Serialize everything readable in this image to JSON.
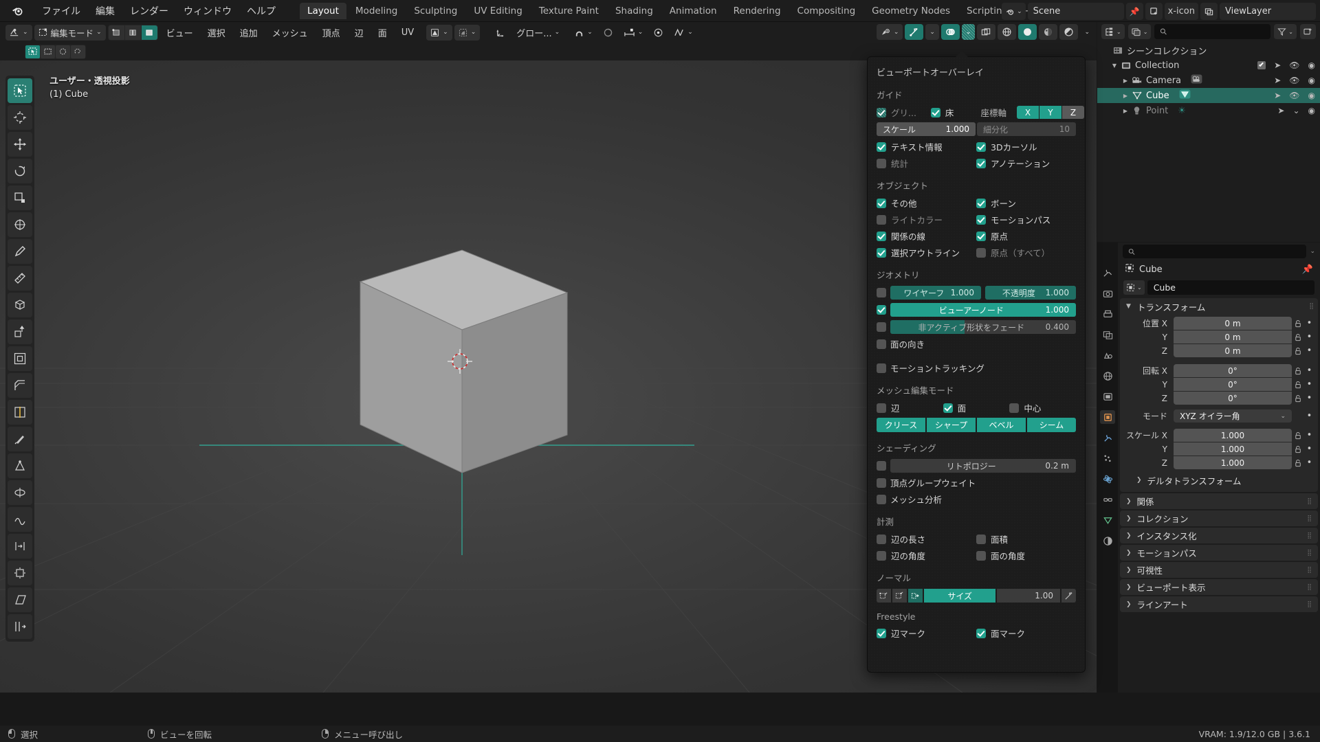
{
  "topbar": {
    "logo_icon": "blender-logo-icon",
    "menus": [
      "ファイル",
      "編集",
      "レンダー",
      "ウィンドウ",
      "ヘルプ"
    ],
    "workspace_tabs": [
      {
        "label": "Layout",
        "active": true
      },
      {
        "label": "Modeling",
        "active": false
      },
      {
        "label": "Sculpting",
        "active": false
      },
      {
        "label": "UV Editing",
        "active": false
      },
      {
        "label": "Texture Paint",
        "active": false
      },
      {
        "label": "Shading",
        "active": false
      },
      {
        "label": "Animation",
        "active": false
      },
      {
        "label": "Rendering",
        "active": false
      },
      {
        "label": "Compositing",
        "active": false
      },
      {
        "label": "Geometry Nodes",
        "active": false
      },
      {
        "label": "Scripting",
        "active": false
      }
    ],
    "add_workspace_label": "+",
    "scene_icon": "scene-icon",
    "scene_name": "Scene",
    "pin_icon": "pin-icon",
    "new_scene_icon": "new-scene-icon",
    "copy_scene_icon": "copy-scene-icon",
    "delete_scene_icon": "x-icon",
    "viewlayer_icon": "view-layer-icon",
    "viewlayer_name": "ViewLayer"
  },
  "viewport_header": {
    "editor_type_icon": "editor-type-icon",
    "mode_icon": "edit-mode-icon",
    "mode_label": "編集モード",
    "select_modes": [
      {
        "name": "vertex-select-mode",
        "on": false
      },
      {
        "name": "edge-select-mode",
        "on": false
      },
      {
        "name": "face-select-mode",
        "on": true
      }
    ],
    "menus": [
      "ビュー",
      "選択",
      "追加",
      "メッシュ",
      "頂点",
      "辺",
      "面",
      "UV"
    ],
    "mesh_option_icons": [
      "mesh-display-icon",
      "uv-option-icon"
    ],
    "transform_orientation_icon": "orientation-icon",
    "transform_orientation_label": "グロー...",
    "snap_icon": "magnet-icon",
    "proportional_icon": "proportional-edit-icon",
    "proportional_falloff_icon": "falloff-icon",
    "mirror_icon": "mirror-x-icon",
    "right_icons": [
      {
        "name": "object-type-visibility-icon",
        "on": false
      },
      {
        "name": "gizmo-icon",
        "on": true
      },
      {
        "name": "overlays-icon",
        "on": true
      },
      {
        "name": "overlays-dropdown-icon",
        "on": true
      },
      {
        "name": "xray-toggle-icon",
        "on": false
      },
      {
        "name": "shading-wireframe-icon",
        "on": false
      },
      {
        "name": "shading-solid-icon",
        "on": true
      },
      {
        "name": "shading-material-icon",
        "on": false
      },
      {
        "name": "shading-rendered-icon",
        "on": false
      }
    ]
  },
  "viewport_subrow": {
    "select_tool_modes": [
      {
        "name": "tweak-select-tool",
        "on": true
      },
      {
        "name": "box-select-tool",
        "on": false
      },
      {
        "name": "circle-select-tool",
        "on": false
      },
      {
        "name": "lasso-select-tool",
        "on": false
      }
    ]
  },
  "viewport": {
    "view_name": "ユーザー・透視投影",
    "object_info": "(1) Cube",
    "tools": [
      {
        "name": "tweak-tool",
        "active": true
      },
      {
        "name": "cursor-tool",
        "active": false
      },
      {
        "name": "move-tool",
        "active": false
      },
      {
        "name": "rotate-tool",
        "active": false
      },
      {
        "name": "scale-tool",
        "active": false
      },
      {
        "name": "transform-tool",
        "active": false
      },
      {
        "name": "annotate-tool",
        "active": false
      },
      {
        "name": "measure-tool",
        "active": false
      },
      {
        "name": "add-cube-tool",
        "active": false
      },
      {
        "name": "extrude-region-tool",
        "active": false
      },
      {
        "name": "inset-faces-tool",
        "active": false
      },
      {
        "name": "bevel-tool",
        "active": false
      },
      {
        "name": "loop-cut-tool",
        "active": false
      },
      {
        "name": "knife-tool",
        "active": false
      },
      {
        "name": "poly-build-tool",
        "active": false
      },
      {
        "name": "spin-tool",
        "active": false
      },
      {
        "name": "smooth-tool",
        "active": false
      },
      {
        "name": "edge-slide-tool",
        "active": false
      },
      {
        "name": "shrink-fatten-tool",
        "active": false
      },
      {
        "name": "shear-tool",
        "active": false
      },
      {
        "name": "rip-region-tool",
        "active": false
      }
    ]
  },
  "overlay_popover": {
    "title": "ビューポートオーバーレイ",
    "guides": {
      "section_label": "ガイド",
      "grid": {
        "label": "グリ...",
        "checked": true,
        "dim": true
      },
      "floor": {
        "label": "床",
        "checked": true
      },
      "axes_label": "座標軸",
      "axes": [
        {
          "label": "X",
          "on": true
        },
        {
          "label": "Y",
          "on": true
        },
        {
          "label": "Z",
          "on": false
        }
      ],
      "scale": {
        "label": "スケール",
        "value": "1.000"
      },
      "subdivision": {
        "label": "細分化",
        "value": "10"
      },
      "text_info": {
        "label": "テキスト情報",
        "checked": true
      },
      "cursor_3d": {
        "label": "3Dカーソル",
        "checked": true
      },
      "statistics": {
        "label": "統計",
        "checked": false
      },
      "annotations": {
        "label": "アノテーション",
        "checked": true
      }
    },
    "objects": {
      "section_label": "オブジェクト",
      "items": [
        {
          "label": "その他",
          "checked": true,
          "dim": false
        },
        {
          "label": "ボーン",
          "checked": true,
          "dim": false
        },
        {
          "label": "ライトカラー",
          "checked": false,
          "dim": true
        },
        {
          "label": "モーションパス",
          "checked": true,
          "dim": false
        },
        {
          "label": "関係の線",
          "checked": true,
          "dim": false
        },
        {
          "label": "原点",
          "checked": true,
          "dim": false
        },
        {
          "label": "選択アウトライン",
          "checked": true,
          "dim": false
        },
        {
          "label": "原点（すべて）",
          "checked": false,
          "dim": true
        }
      ]
    },
    "geometry": {
      "section_label": "ジオメトリ",
      "wireframe": {
        "label": "ワイヤーフ",
        "value": "1.000",
        "checked": false
      },
      "opacity": {
        "label": "不透明度",
        "value": "1.000"
      },
      "viewer_node": {
        "label": "ビューアーノード",
        "value": "1.000",
        "checked": true
      },
      "fade_inactive": {
        "label": "非アクティブ形状をフェード",
        "value": "0.400",
        "checked": false
      },
      "face_orientation": {
        "label": "面の向き",
        "checked": false
      },
      "motion_tracking": {
        "label": "モーショントラッキング",
        "checked": false
      }
    },
    "mesh_edit_mode": {
      "section_label": "メッシュ編集モード",
      "edge": {
        "label": "辺",
        "checked": false
      },
      "face": {
        "label": "面",
        "checked": true
      },
      "center": {
        "label": "中心",
        "checked": false
      },
      "pills": [
        {
          "label": "クリース",
          "on": true
        },
        {
          "label": "シャープ",
          "on": true
        },
        {
          "label": "ベベル",
          "on": true
        },
        {
          "label": "シーム",
          "on": true
        }
      ]
    },
    "shading": {
      "section_label": "シェーディング",
      "retopology": {
        "label": "リトポロジー",
        "value": "0.2 m",
        "checked": false
      },
      "vertex_group_weights": {
        "label": "頂点グループウェイト",
        "checked": false
      },
      "mesh_analysis": {
        "label": "メッシュ分析",
        "checked": false
      }
    },
    "measurement": {
      "section_label": "計測",
      "items": [
        {
          "label": "辺の長さ",
          "checked": false
        },
        {
          "label": "面積",
          "checked": false
        },
        {
          "label": "辺の角度",
          "checked": false
        },
        {
          "label": "面の角度",
          "checked": false
        }
      ]
    },
    "normals": {
      "section_label": "ノーマル",
      "toggles": [
        {
          "name": "vertex-normals-icon",
          "on": false
        },
        {
          "name": "split-normals-icon",
          "on": false
        },
        {
          "name": "face-normals-icon",
          "on": true
        }
      ],
      "size": {
        "label": "サイズ",
        "value": "1.00"
      },
      "custom_normals_icon": "custom-normals-icon"
    },
    "freestyle": {
      "section_label": "Freestyle",
      "edge_marks": {
        "label": "辺マーク",
        "checked": true
      },
      "face_marks": {
        "label": "面マーク",
        "checked": true
      }
    }
  },
  "outliner": {
    "display_mode_icon": "outliner-display-mode-icon",
    "filter_id_icon": "filter-id-icon",
    "search_placeholder": "",
    "filter_icon": "funnel-icon",
    "new_collection_icon": "new-collection-icon",
    "rows": [
      {
        "name": "シーンコレクション",
        "indent": 0,
        "icon": "scene-collection-icon",
        "tri": "",
        "selected": false,
        "dim": false,
        "checkbox": false,
        "restrict": []
      },
      {
        "name": "Collection",
        "indent": 1,
        "icon": "collection-icon",
        "tri": "▼",
        "selected": false,
        "dim": false,
        "checkbox": true,
        "restrict": [
          "selectable-icon",
          "hide-icon",
          "render-icon"
        ]
      },
      {
        "name": "Camera",
        "indent": 2,
        "icon": "camera-icon",
        "tri": "▶",
        "selected": false,
        "dim": false,
        "checkbox": false,
        "restrict": [
          "selectable-icon",
          "hide-icon",
          "render-icon"
        ]
      },
      {
        "name": "Cube",
        "indent": 2,
        "icon": "mesh-icon",
        "tri": "▶",
        "selected": true,
        "dim": false,
        "checkbox": false,
        "restrict": [
          "selectable-icon",
          "hide-icon",
          "render-icon"
        ]
      },
      {
        "name": "Point",
        "indent": 2,
        "icon": "light-icon",
        "tri": "▶",
        "selected": false,
        "dim": true,
        "checkbox": false,
        "restrict": [
          "selectable-icon",
          "hidden-icon",
          "render-icon"
        ]
      }
    ]
  },
  "properties": {
    "search_placeholder": "",
    "tabs": [
      {
        "name": "tool-tab",
        "icon": "wrench-screwdriver-icon",
        "active": false
      },
      {
        "name": "render-tab",
        "icon": "camera-back-icon",
        "active": false
      },
      {
        "name": "output-tab",
        "icon": "printer-icon",
        "active": false
      },
      {
        "name": "view-layer-tab",
        "icon": "images-icon",
        "active": false
      },
      {
        "name": "scene-tab",
        "icon": "cone-sphere-icon",
        "active": false
      },
      {
        "name": "world-tab",
        "icon": "globe-icon",
        "active": false
      },
      {
        "name": "collection-tab",
        "icon": "box-icon",
        "active": false
      },
      {
        "name": "object-tab",
        "icon": "orange-square-icon",
        "active": true
      },
      {
        "name": "modifier-tab",
        "icon": "wrench-icon",
        "active": false
      },
      {
        "name": "particles-tab",
        "icon": "particles-icon",
        "active": false
      },
      {
        "name": "physics-tab",
        "icon": "orbit-icon",
        "active": false
      },
      {
        "name": "constraints-tab",
        "icon": "constraint-icon",
        "active": false
      },
      {
        "name": "data-tab",
        "icon": "green-triangle-icon",
        "active": false
      },
      {
        "name": "material-tab",
        "icon": "sphere-checker-icon",
        "active": false
      }
    ],
    "breadcrumb_icon": "object-icon",
    "breadcrumb_label": "Cube",
    "pin_icon": "pin-icon",
    "name_field_icon": "object-icon",
    "name_value": "Cube",
    "transform": {
      "panel_label": "トランスフォーム",
      "location": {
        "label": "位置 X",
        "labels": [
          "位置 X",
          "Y",
          "Z"
        ],
        "values": [
          "0 m",
          "0 m",
          "0 m"
        ]
      },
      "rotation": {
        "labels": [
          "回転 X",
          "Y",
          "Z"
        ],
        "values": [
          "0°",
          "0°",
          "0°"
        ]
      },
      "mode": {
        "label": "モード",
        "value": "XYZ オイラー角"
      },
      "scale": {
        "labels": [
          "スケール X",
          "Y",
          "Z"
        ],
        "values": [
          "1.000",
          "1.000",
          "1.000"
        ]
      },
      "delta_transform_label": "デルタトランスフォーム"
    },
    "collapsed_panels": [
      "関係",
      "コレクション",
      "インスタンス化",
      "モーションパス",
      "可視性",
      "ビューポート表示",
      "ラインアート"
    ]
  },
  "status_bar": {
    "items": [
      {
        "mouse": "left",
        "label": "選択"
      },
      {
        "mouse": "middle",
        "label": "ビューを回転"
      },
      {
        "mouse": "right",
        "label": "メニュー呼び出し"
      }
    ],
    "right_text": "VRAM: 1.9/12.0 GB | 3.6.1"
  },
  "colors": {
    "accent_teal": "#22a08d",
    "selection_teal": "#27695f",
    "panel_bg": "#1d1d1d",
    "field_grey": "#545454"
  }
}
